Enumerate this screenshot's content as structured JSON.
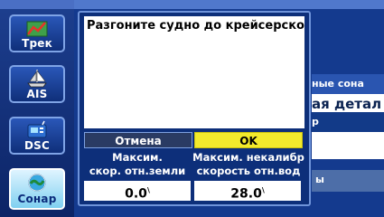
{
  "sidebar": {
    "items": [
      {
        "label": "Трек",
        "icon": "track-icon"
      },
      {
        "label": "AIS",
        "icon": "ship-icon"
      },
      {
        "label": "DSC",
        "icon": "dsc-icon"
      },
      {
        "label": "Сонар",
        "icon": "sonar-icon"
      }
    ]
  },
  "background_rows": [
    {
      "text": "ные сона"
    },
    {
      "text": "ая детал"
    },
    {
      "text": "р"
    },
    {
      "text": "ы"
    }
  ],
  "dialog": {
    "message": "Разгоните судно до крейсерско",
    "cancel_label": "Отмена",
    "ok_label": "OK",
    "left_caption_line1": "Максим.",
    "left_caption_line2": "скор. отн.земли",
    "right_caption_line1": "Максим. некалибр",
    "right_caption_line2": "скорость отн.вод",
    "left_value": "0.0",
    "right_value": "28.0",
    "unit_mark": "\\"
  },
  "colors": {
    "ok_button": "#f2ea2c",
    "background": "#143a8e"
  }
}
